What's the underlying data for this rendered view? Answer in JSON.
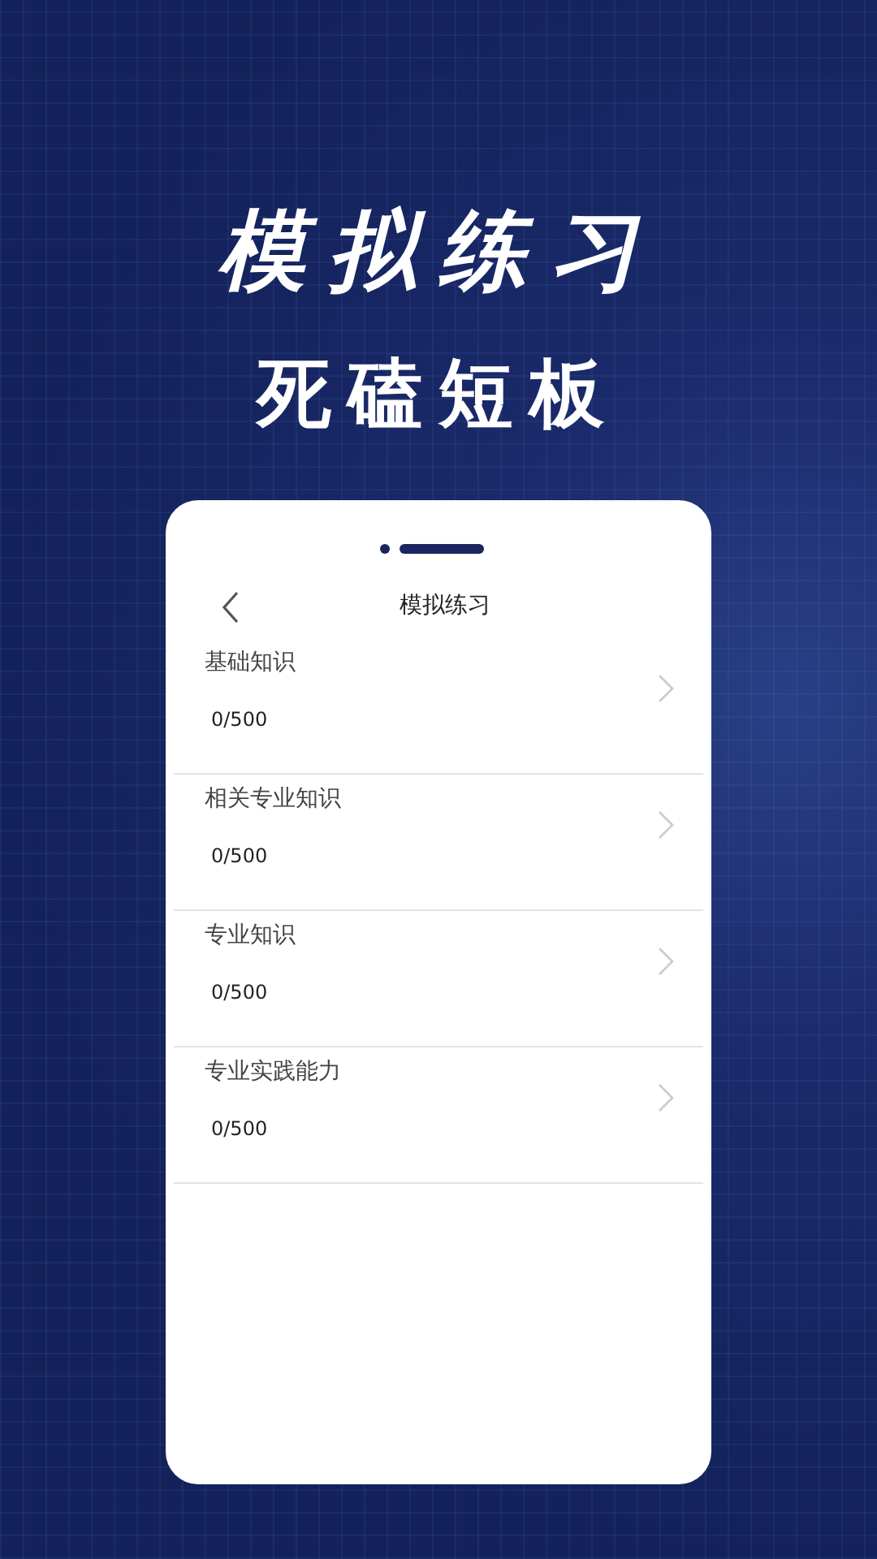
{
  "headline": "模拟练习",
  "subheadline": "死磕短板",
  "phone": {
    "nav": {
      "title": "模拟练习"
    },
    "items": [
      {
        "title": "基础知识",
        "progress": "0/500"
      },
      {
        "title": "相关专业知识",
        "progress": "0/500"
      },
      {
        "title": "专业知识",
        "progress": "0/500"
      },
      {
        "title": "专业实践能力",
        "progress": "0/500"
      }
    ]
  }
}
